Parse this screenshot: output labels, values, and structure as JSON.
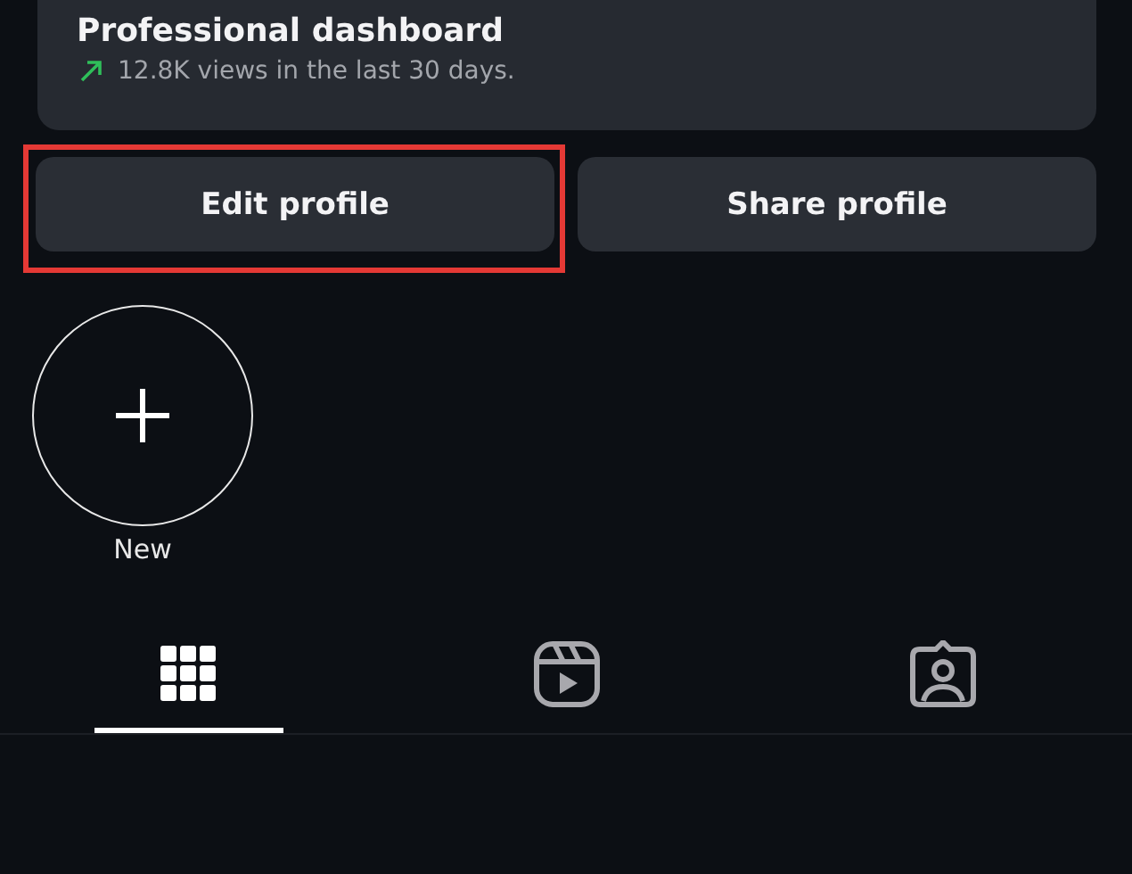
{
  "dashboard": {
    "title": "Professional dashboard",
    "rising": true,
    "stat": "12.8K views in the last 30 days."
  },
  "buttons": [
    {
      "label": "Edit profile",
      "highlighted": true
    },
    {
      "label": "Share profile",
      "highlighted": false
    }
  ],
  "highlights": [
    {
      "label": "New",
      "kind": "new"
    }
  ],
  "tabs": [
    {
      "kind": "grid",
      "selected": true
    },
    {
      "kind": "reels",
      "selected": false
    },
    {
      "kind": "tagged",
      "selected": false
    }
  ]
}
